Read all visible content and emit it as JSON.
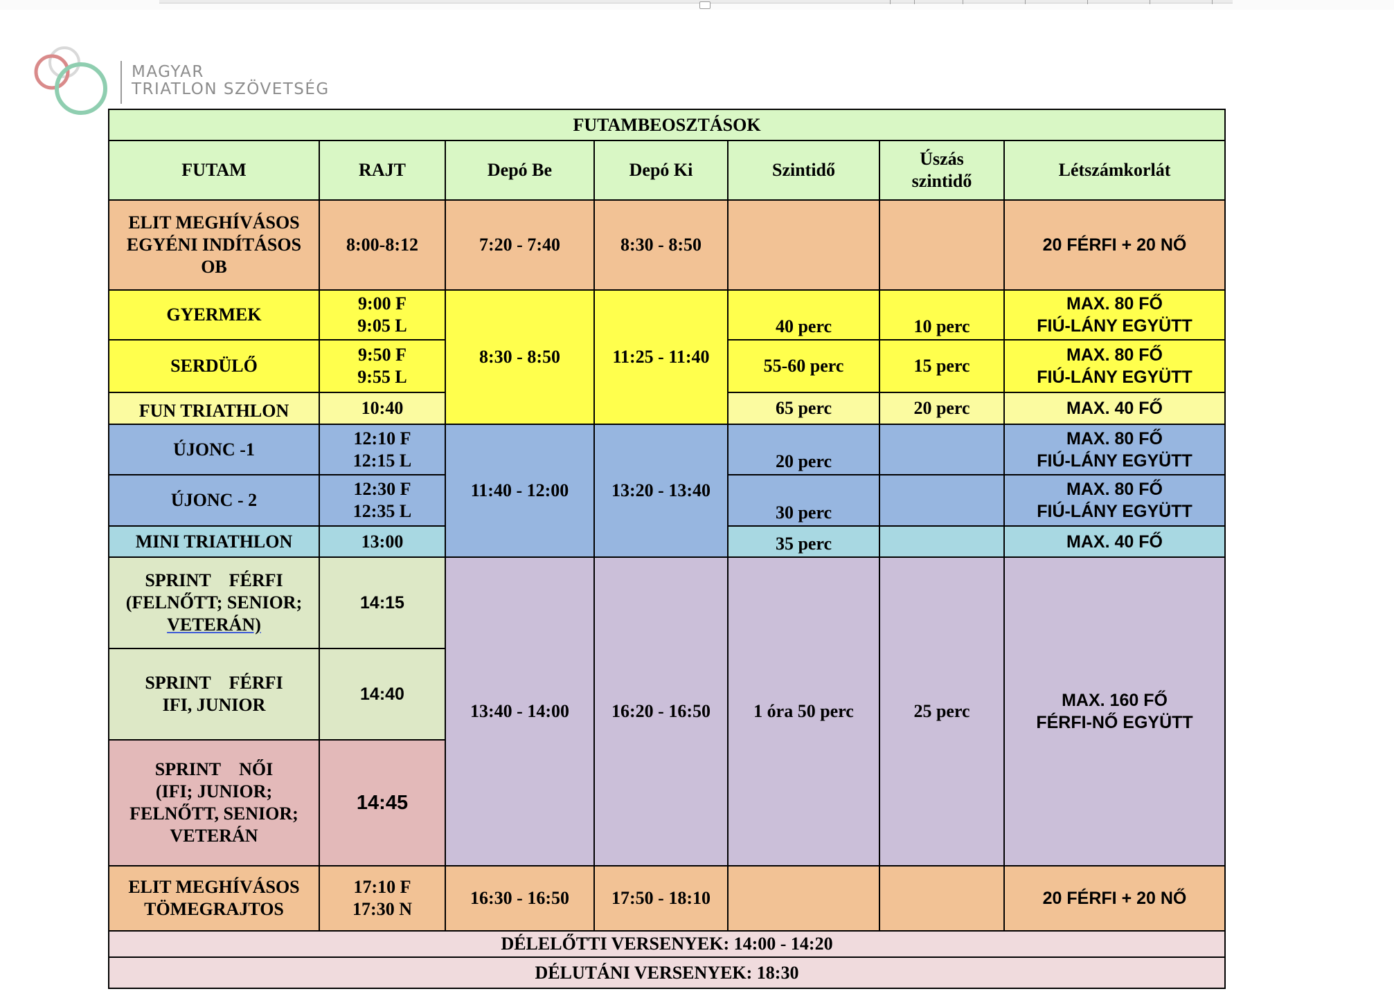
{
  "logo": {
    "line1": "MAGYAR",
    "line2": "TRIATLON SZÖVETSÉG",
    "ring_colors": [
      "#d98a8a",
      "#8fceb0",
      "#d9d9d9"
    ]
  },
  "colors": {
    "header": "#d9f7c5",
    "orange": "#f2c295",
    "yellow": "#ffff4d",
    "light_yellow": "#fbfba0",
    "blue": "#97b6e0",
    "light_blue": "#a8d8e2",
    "green_gray": "#dde8c6",
    "purple": "#cbbfd9",
    "pink": "#e3b9b9",
    "footer": "#f0dbdd"
  },
  "table": {
    "title": "FUTAMBEOSZTÁSOK",
    "headers": {
      "futam": "FUTAM",
      "rajt": "RAJT",
      "depo_be": "Depó Be",
      "depo_ki": "Depó Ki",
      "szintido": "Szintidő",
      "uszas_1": "Úszás",
      "uszas_2": "szintidő",
      "letszam": "Létszámkorlát"
    },
    "rows": {
      "elit_egyeni": {
        "futam_1": "ELIT MEGHÍVÁSOS",
        "futam_2": "EGYÉNI INDÍTÁSOS",
        "futam_3": "OB",
        "rajt": "8:00-8:12",
        "depo_be": "7:20 - 7:40",
        "depo_ki": "8:30 - 8:50",
        "letszam": "20 FÉRFI + 20 NŐ"
      },
      "gyermek": {
        "futam": "GYERMEK",
        "rajt_1": "9:00 F",
        "rajt_2": "9:05 L",
        "szintido": "40 perc",
        "uszas": "10 perc",
        "letszam_1": "MAX. 80 FŐ",
        "letszam_2": "FIÚ-LÁNY EGYÜTT"
      },
      "serdulo": {
        "futam": "SERDÜLŐ",
        "rajt_1": "9:50 F",
        "rajt_2": "9:55 L",
        "szintido": "55-60 perc",
        "uszas": "15 perc",
        "letszam_1": "MAX. 80 FŐ",
        "letszam_2": "FIÚ-LÁNY EGYÜTT"
      },
      "fun": {
        "futam": "FUN TRIATHLON",
        "rajt": "10:40",
        "szintido": "65 perc",
        "uszas": "20 perc",
        "letszam": "MAX. 40 FŐ"
      },
      "morning_depo": {
        "depo_be": "8:30 - 8:50",
        "depo_ki": "11:25 - 11:40"
      },
      "ujonc1": {
        "futam": "ÚJONC -1",
        "rajt_1": "12:10 F",
        "rajt_2": "12:15 L",
        "szintido": "20 perc",
        "letszam_1": "MAX. 80 FŐ",
        "letszam_2": "FIÚ-LÁNY EGYÜTT"
      },
      "ujonc2": {
        "futam": "ÚJONC - 2",
        "rajt_1": "12:30 F",
        "rajt_2": "12:35 L",
        "szintido": "30 perc",
        "letszam_1": "MAX. 80 FŐ",
        "letszam_2": "FIÚ-LÁNY EGYÜTT"
      },
      "mini": {
        "futam": "MINI TRIATHLON",
        "rajt": "13:00",
        "szintido": "35 perc",
        "letszam": "MAX. 40 FŐ"
      },
      "midday_depo": {
        "depo_be": "11:40 - 12:00",
        "depo_ki": "13:20 - 13:40"
      },
      "sprint_ferfi_felnott": {
        "futam_1a": "SPRINT",
        "futam_1b": "FÉRFI",
        "futam_2": "(FELNŐTT; SENIOR;",
        "futam_3": "VETERÁN)",
        "rajt": "14:15"
      },
      "sprint_ferfi_ifi": {
        "futam_1a": "SPRINT",
        "futam_1b": "FÉRFI",
        "futam_2": "IFI, JUNIOR",
        "rajt": "14:40"
      },
      "sprint_noi": {
        "futam_1a": "SPRINT",
        "futam_1b": "NŐI",
        "futam_2": "(IFI; JUNIOR;",
        "futam_3": "FELNŐTT, SENIOR;",
        "futam_4": "VETERÁN",
        "rajt": "14:45"
      },
      "sprint_shared": {
        "depo_be": "13:40 - 14:00",
        "depo_ki": "16:20 - 16:50",
        "szintido": "1 óra 50 perc",
        "uszas": "25 perc",
        "letszam_1": "MAX. 160 FŐ",
        "letszam_2": "FÉRFI-NŐ EGYÜTT"
      },
      "elit_tomeg": {
        "futam_1": "ELIT MEGHÍVÁSOS",
        "futam_2": "TÖMEGRAJTOS",
        "rajt_1": "17:10 F",
        "rajt_2": "17:30 N",
        "depo_be": "16:30 - 16:50",
        "depo_ki": "17:50 - 18:10",
        "letszam": "20 FÉRFI + 20 NŐ"
      }
    },
    "footer_1": "DÉLELŐTTI VERSENYEK: 14:00 - 14:20",
    "footer_2": "DÉLUTÁNI VERSENYEK: 18:30"
  }
}
